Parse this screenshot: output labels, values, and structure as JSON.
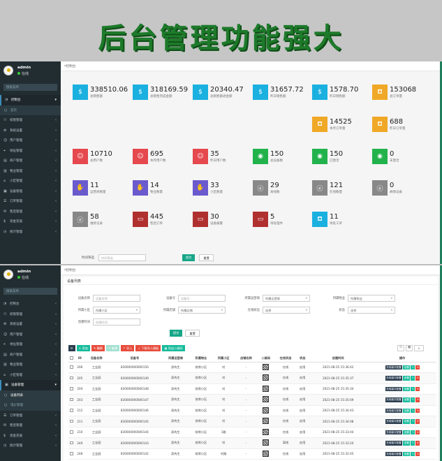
{
  "banner": {
    "title": "后台管理功能强大"
  },
  "common": {
    "user": "admin",
    "status": "在线",
    "search_placeholder": "搜索菜单"
  },
  "win1": {
    "breadcrumb": "控制台",
    "sidebar": [
      {
        "label": "控制台",
        "icon": "dashboard-icon",
        "active": true
      },
      {
        "label": "首页",
        "icon": "circle-icon",
        "sub": true
      },
      {
        "label": "权限管理",
        "icon": "group-icon"
      },
      {
        "label": "系统设置",
        "icon": "cogs-icon"
      },
      {
        "label": "用户管理",
        "icon": "user-icon"
      },
      {
        "label": "地址管理",
        "icon": "map-icon"
      },
      {
        "label": "商户管理",
        "icon": "store-icon"
      },
      {
        "label": "物业管理",
        "icon": "building-icon"
      },
      {
        "label": "小区管理",
        "icon": "home-icon"
      },
      {
        "label": "设备管理",
        "icon": "device-icon"
      },
      {
        "label": "订单管理",
        "icon": "order-icon"
      },
      {
        "label": "售后管理",
        "icon": "service-icon"
      },
      {
        "label": "资金充值",
        "icon": "money-icon"
      },
      {
        "label": "统计管理",
        "icon": "chart-icon"
      }
    ],
    "stats": [
      {
        "value": "338510.06",
        "label": "总销售额",
        "color": "#1ab0e0",
        "icon": "money-icon"
      },
      {
        "value": "318169.59",
        "label": "总销售完成金额",
        "color": "#1ab0e0",
        "icon": "money-icon"
      },
      {
        "value": "20340.47",
        "label": "总销售额退金额",
        "color": "#1ab0e0",
        "icon": "money-icon"
      },
      {
        "value": "31657.72",
        "label": "昨日销售额",
        "color": "#1ab0e0",
        "icon": "money-icon"
      },
      {
        "value": "1578.70",
        "label": "昨日销售额",
        "color": "#1ab0e0",
        "icon": "money-icon"
      },
      {
        "value": "153068",
        "label": "总订单量",
        "color": "#f0a827",
        "icon": "bag-icon"
      },
      {
        "value": "14525",
        "label": "本月订单量",
        "color": "#f0a827",
        "icon": "bag-icon"
      },
      {
        "value": "688",
        "label": "昨日订单量",
        "color": "#f0a827",
        "icon": "bag-icon"
      },
      {
        "value": "10710",
        "label": "总用户数",
        "color": "#e5484d",
        "icon": "user-icon"
      },
      {
        "value": "695",
        "label": "本月用户数",
        "color": "#e5484d",
        "icon": "user-icon"
      },
      {
        "value": "35",
        "label": "昨日用户数",
        "color": "#e5484d",
        "icon": "user-icon"
      },
      {
        "value": "150",
        "label": "总设备数",
        "color": "#22b24c",
        "icon": "signal-icon"
      },
      {
        "value": "150",
        "label": "已激活",
        "color": "#22b24c",
        "icon": "signal-icon"
      },
      {
        "value": "0",
        "label": "未激活",
        "color": "#22b24c",
        "icon": "signal-icon"
      },
      {
        "value": "11",
        "label": "运营商数量",
        "color": "#6a5acd",
        "icon": "handshake-icon"
      },
      {
        "value": "14",
        "label": "物业数量",
        "color": "#6a5acd",
        "icon": "handshake-icon"
      },
      {
        "value": "33",
        "label": "小区数量",
        "color": "#6a5acd",
        "icon": "handshake-icon"
      },
      {
        "value": "29",
        "label": "离线数",
        "color": "#888888",
        "icon": "ie-icon"
      },
      {
        "value": "121",
        "label": "在线数量",
        "color": "#888888",
        "icon": "ie-icon"
      },
      {
        "value": "0",
        "label": "故障设备",
        "color": "#888888",
        "icon": "ie-icon"
      },
      {
        "value": "58",
        "label": "维修记录",
        "color": "#888888",
        "icon": "ie-icon"
      },
      {
        "value": "445",
        "label": "售后订单",
        "color": "#b03030",
        "icon": "screen-icon"
      },
      {
        "value": "30",
        "label": "设备报警",
        "color": "#b03030",
        "icon": "screen-icon"
      },
      {
        "value": "5",
        "label": "待处理件",
        "color": "#b03030",
        "icon": "screen-icon"
      },
      {
        "value": "11",
        "label": "待处工单",
        "color": "#1ab0e0",
        "icon": "bag-icon"
      }
    ],
    "filter": {
      "label": "时间筛选",
      "placeholder": "时间筛选",
      "submit": "提交",
      "reset": "重置"
    }
  },
  "win2": {
    "breadcrumb": "控制台",
    "sidebar": [
      {
        "label": "控制台",
        "icon": "dashboard-icon"
      },
      {
        "label": "权限管理",
        "icon": "group-icon"
      },
      {
        "label": "系统设置",
        "icon": "cogs-icon"
      },
      {
        "label": "用户管理",
        "icon": "user-icon"
      },
      {
        "label": "地址管理",
        "icon": "map-icon"
      },
      {
        "label": "商户管理",
        "icon": "store-icon"
      },
      {
        "label": "物业管理",
        "icon": "building-icon"
      },
      {
        "label": "小区管理",
        "icon": "home-icon"
      },
      {
        "label": "设备管理",
        "icon": "device-icon",
        "active": true
      },
      {
        "label": "设备列表",
        "icon": "circle-icon",
        "sub": true,
        "cur": true
      },
      {
        "label": "电价管理",
        "icon": "circle-icon",
        "sub": true
      },
      {
        "label": "订单管理",
        "icon": "order-icon"
      },
      {
        "label": "售后管理",
        "icon": "service-icon"
      },
      {
        "label": "资金充值",
        "icon": "money-icon"
      },
      {
        "label": "统计管理",
        "icon": "chart-icon"
      }
    ],
    "panel_title": "设备列表",
    "filters": [
      {
        "label": "设备名称",
        "placeholder": "设备名称",
        "type": "input"
      },
      {
        "label": "设备号",
        "placeholder": "设备号",
        "type": "input"
      },
      {
        "label": "所属运营商",
        "placeholder": "所属运营商",
        "type": "select"
      },
      {
        "label": "所属物业",
        "placeholder": "所属物业",
        "type": "select"
      },
      {
        "label": "所属小区",
        "placeholder": "所属小区",
        "type": "select"
      },
      {
        "label": "所属店铺",
        "placeholder": "所属店铺",
        "type": "select"
      },
      {
        "label": "在线状态",
        "placeholder": "选择",
        "type": "select"
      },
      {
        "label": "状态",
        "placeholder": "选择",
        "type": "select"
      },
      {
        "label": "创建时间",
        "placeholder": "创建时间",
        "type": "input"
      }
    ],
    "filter_submit": "提交",
    "filter_reset": "重置",
    "toolbar": [
      {
        "label": "⟳",
        "color": "#2c3e50"
      },
      {
        "label": "+ 添加",
        "color": "#18bc9c"
      },
      {
        "label": "✎ 编辑",
        "color": "#e74c3c"
      },
      {
        "label": "✎ 编辑",
        "color": "#a3e0cf"
      },
      {
        "label": "⇡ 导入",
        "color": "#e74c3c"
      },
      {
        "label": "⇣ 下载导入模板",
        "color": "#e74c3c"
      },
      {
        "label": "▦ 导出二维码",
        "color": "#18bc9c"
      }
    ],
    "columns": [
      "ID",
      "设备名称",
      "设备号",
      "所属运营商",
      "所属物业",
      "所属小区",
      "店铺名称",
      "二维码",
      "在线状态",
      "状态",
      "创建时间",
      "操作"
    ],
    "rows": [
      [
        "206",
        "工业园",
        "830000000000150",
        "邱先生",
        "前常小区",
        "村",
        "-",
        "在线",
        "启用",
        "2021-08-25 15:36:42"
      ],
      [
        "205",
        "工业园",
        "830000000000149",
        "邱先生",
        "前常小区",
        "村",
        "-",
        "在线",
        "启用",
        "2021-08-25 15:35:37"
      ],
      [
        "204",
        "工业园",
        "830000000000148",
        "邱先生",
        "前常小区",
        "村",
        "-",
        "在线",
        "启用",
        "2021-08-25 15:35:34"
      ],
      [
        "203",
        "工业园",
        "830000000000147",
        "邱先生",
        "前常小区",
        "村",
        "-",
        "在线",
        "启用",
        "2021-08-25 15:35:09"
      ],
      [
        "212",
        "工业园",
        "830000000000146",
        "邱先生",
        "前常小区",
        "村",
        "-",
        "在线",
        "启用",
        "2021-08-25 15:34:43"
      ],
      [
        "211",
        "工业园",
        "830000000000145",
        "邱先生",
        "前常小区",
        "村",
        "-",
        "在线",
        "启用",
        "2021-08-25 15:34:08"
      ],
      [
        "210",
        "工业园",
        "830000000000144",
        "邱先生",
        "前常小区",
        "1路",
        "-",
        "在线",
        "启用",
        "2021-08-25 15:33:44"
      ],
      [
        "249",
        "工业园",
        "830000000000143",
        "邱先生",
        "前常小区",
        "村",
        "-",
        "离线",
        "启用",
        "2021-08-25 15:33:20"
      ],
      [
        "248",
        "工业园",
        "830000000000142",
        "邱先生",
        "前常小区",
        "村路",
        "-",
        "在线",
        "启用",
        "2021-08-25 15:32:45"
      ]
    ],
    "op_labels": [
      "充电端口配置",
      "设置",
      "✎",
      "✕"
    ]
  }
}
